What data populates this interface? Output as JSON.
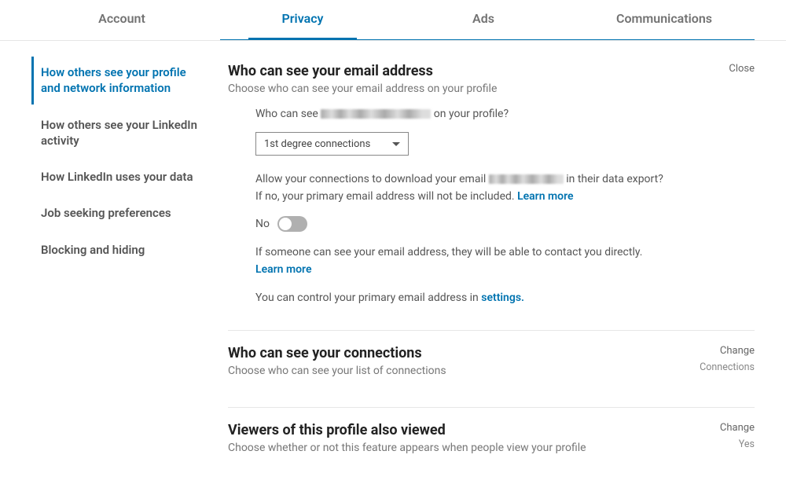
{
  "topnav": {
    "items": [
      "Account",
      "Privacy",
      "Ads",
      "Communications"
    ],
    "activeIndex": 1
  },
  "sidebar": {
    "items": [
      "How others see your profile and network information",
      "How others see your LinkedIn activity",
      "How LinkedIn uses your data",
      "Job seeking preferences",
      "Blocking and hiding"
    ],
    "activeIndex": 0
  },
  "section_email": {
    "title": "Who can see your email address",
    "sub": "Choose who can see your email address on your profile",
    "action": "Close",
    "question_pre": "Who can see ",
    "question_post": " on your profile?",
    "select_value": "1st degree connections",
    "allow_pre": "Allow your connections to download your email ",
    "allow_post": " in their data export? If no, your primary email address will not be included. ",
    "learn_more": "Learn more",
    "toggle_label": "No",
    "contact_text": "If someone can see your email address, they will be able to contact you directly. ",
    "settings_pre": "You can control your primary email address in ",
    "settings_link": "settings."
  },
  "section_connections": {
    "title": "Who can see your connections",
    "sub": "Choose who can see your list of connections",
    "action": "Change",
    "value": "Connections"
  },
  "section_viewers": {
    "title": "Viewers of this profile also viewed",
    "sub": "Choose whether or not this feature appears when people view your profile",
    "action": "Change",
    "value": "Yes"
  }
}
